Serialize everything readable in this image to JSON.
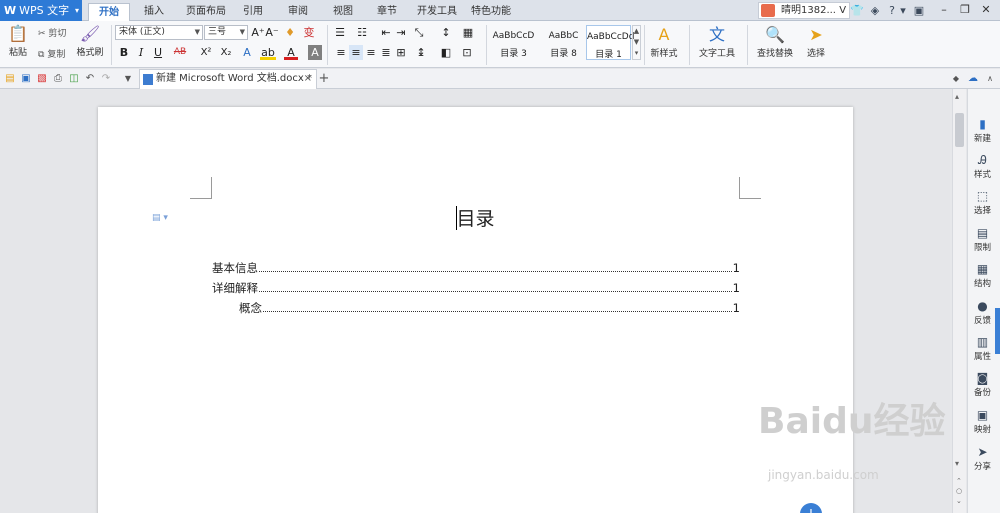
{
  "app": {
    "logo": "W",
    "name": "WPS 文字",
    "menu_arrow": "▾"
  },
  "tabs": [
    "开始",
    "插入",
    "页面布局",
    "引用",
    "审阅",
    "视图",
    "章节",
    "开发工具",
    "特色功能"
  ],
  "active_tab": "开始",
  "user": {
    "name": "晴明1382...",
    "badge": "V",
    "arrow": "▾"
  },
  "title_icons": {
    "shirt": "👕",
    "skin": "◈",
    "help": "?",
    "more": "▾",
    "pin": "▣"
  },
  "window": {
    "minimize": "–",
    "restore": "❐",
    "close": "✕"
  },
  "ribbon": {
    "paste": "粘贴",
    "cut": "剪切",
    "copy": "复制",
    "format_painter": "格式刷",
    "font_name": "宋体 (正文)",
    "font_size": "三号",
    "grow": "A⁺",
    "shrink": "A⁻",
    "clear_format": "♦",
    "phonetic": "变",
    "bold": "B",
    "italic": "I",
    "underline": "U",
    "strike": "AB",
    "superscript": "X²",
    "subscript": "X₂",
    "text_effect": "A",
    "highlight": "ab",
    "font_color": "A",
    "char_shade": "A",
    "styles": [
      {
        "preview": "AaBbCcD",
        "name": "目录 3"
      },
      {
        "preview": "AaBbC",
        "name": "目录 8"
      },
      {
        "preview": "AaBbCcDd",
        "name": "目录 1"
      }
    ],
    "new_style": "新样式",
    "text_tools": "文字工具",
    "find_replace": "查找替换",
    "select": "选择"
  },
  "document": {
    "tab_title": "新建 Microsoft Word 文档.docx *",
    "close": "×",
    "add_tab": "+",
    "heading": "目录",
    "toc": [
      {
        "text": "基本信息",
        "page": "1",
        "level": 1
      },
      {
        "text": "详细解释",
        "page": "1",
        "level": 1
      },
      {
        "text": "概念",
        "page": "1",
        "level": 2
      }
    ]
  },
  "right_panel": [
    "新建",
    "样式",
    "选择",
    "限制",
    "结构",
    "反馈",
    "属性",
    "备份",
    "映射",
    "分享"
  ],
  "watermark": {
    "main": "Baidu经验",
    "sub": "jingyan.baidu.com"
  },
  "colors": {
    "accent": "#2d7ad6",
    "highlight": "#f5d000",
    "font_color": "#d62020",
    "shade": "#808080"
  }
}
